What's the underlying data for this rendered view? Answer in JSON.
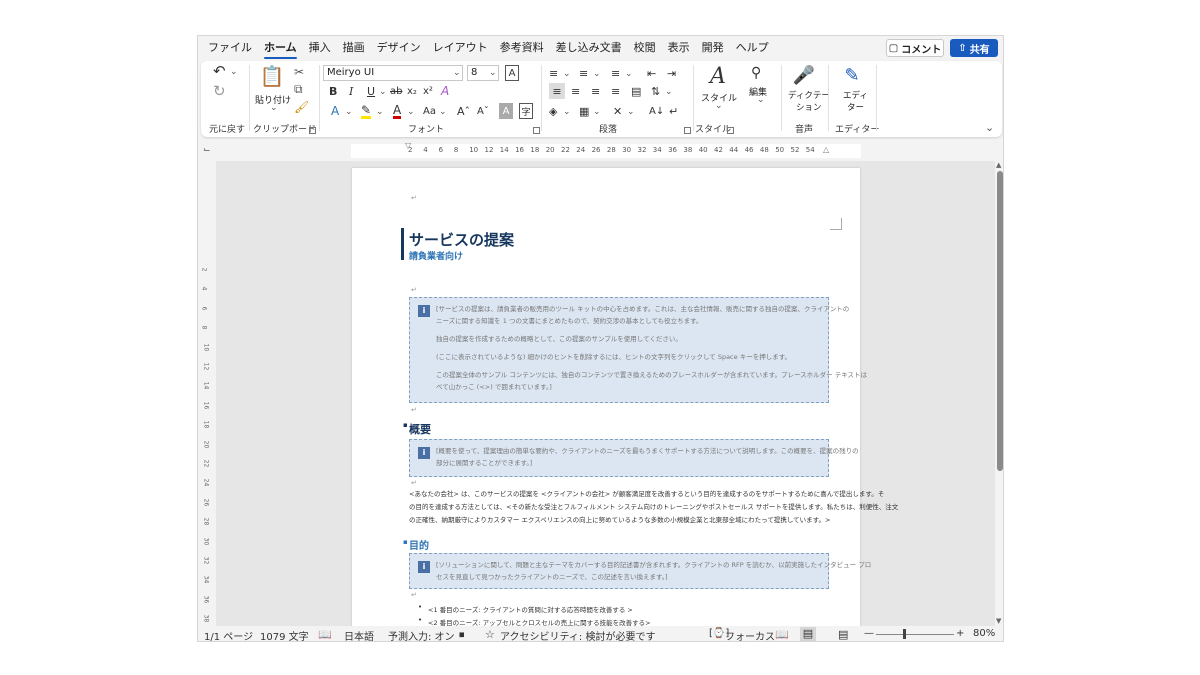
{
  "tabs": [
    "ファイル",
    "ホーム",
    "挿入",
    "描画",
    "デザイン",
    "レイアウト",
    "参考資料",
    "差し込み文書",
    "校閲",
    "表示",
    "開発",
    "ヘルプ"
  ],
  "comment_label": "コメント",
  "share_label": "共有",
  "ribbon": {
    "undo_group": "元に戻す",
    "clipboard_group": "クリップボード",
    "paste_label": "貼り付け",
    "font_group": "フォント",
    "font_name": "Meiryo UI",
    "font_size": "8",
    "paragraph_group": "段落",
    "styles_group": "スタイル",
    "styles_btn": "スタイル",
    "editing_btn": "編集",
    "dictation_btn1": "ディクテー",
    "dictation_btn2": "ション",
    "voice_group": "音声",
    "editor_btn1": "エディ",
    "editor_btn2": "ター",
    "editor_group": "エディター"
  },
  "ruler_ticks": [
    "2",
    "4",
    "6",
    "8",
    "10",
    "12",
    "14",
    "16",
    "18",
    "20",
    "22",
    "24",
    "26",
    "28",
    "30",
    "32",
    "34",
    "36",
    "38",
    "40",
    "42",
    "44",
    "46",
    "48",
    "50",
    "52",
    "54"
  ],
  "vruler_ticks": [
    "2",
    "4",
    "6",
    "8",
    "10",
    "12",
    "14",
    "16",
    "18",
    "20",
    "22",
    "24",
    "26",
    "28",
    "30",
    "32",
    "34",
    "36",
    "38"
  ],
  "doc": {
    "title": "サービスの提案",
    "subtitle": "請負業者向け",
    "tip1": [
      "[サービスの提案は、請負業者の販売用のツール キットの中心を占めます。これは、主な会社情報、販売に関する独自の提案、クライアントの",
      "ニーズに関する知識を 1 つの文書にまとめたもので、契約交渉の基本としても役立ちます。",
      "独自の提案を作成するための概略として、この提案のサンプルを使用してください。",
      "(ここに表示されているような) 細かけのヒントを削除するには、ヒントの文字列をクリックして Space キーを押します。",
      "この提案全体のサンプル コンテンツには、独自のコンテンツで置き換えるためのプレースホルダーが含まれています。プレースホルダー テキストは",
      "べて山かっこ (<>) で囲まれています。]"
    ],
    "h_overview": "概要",
    "tip2": [
      "[概要を使って、提案理由の簡単な要約や、クライアントのニーズを最もうまくサポートする方法について説明します。この概要を、提案の残りの",
      "部分に展開することができます。]"
    ],
    "body1": [
      "<あなたの会社> は、このサービスの提案を <クライアントの会社> が顧客満足度を改善するという目的を達成するのをサポートするために喜んで提出します。そ",
      "の目的を達成する方法としては、<その新たな受注とフルフィルメント システム向けのトレーニングやポストセールス サポートを提供します。私たちは、利便性、注文",
      "の正確性、納期厳守によりカスタマー エクスペリエンスの向上に努めているような多数の小規模企業と北東部全域にわたって提携しています。> "
    ],
    "h_purpose": "目的",
    "tip3": [
      "[ソリューションに関して、問題と主なテーマをカバーする目的記述書が含まれます。クライアントの RFP を読むか、以前実施したインタビュー プロ",
      "セスを見直して見つかったクライアントのニーズで、この記述を言い換えます。]"
    ],
    "bullets": [
      "<1 番目のニーズ: クライアントの質問に対する応答時間を改善する >",
      "<2 番目のニーズ: アップセルとクロスセルの売上に関する技能を改善する>"
    ]
  },
  "status": {
    "page": "1/1 ページ",
    "words": "1079 文字",
    "language": "日本語",
    "prediction": "予測入力: オン",
    "accessibility": "アクセシビリティ: 検討が必要です",
    "focus": "フォーカス",
    "zoom": "80%"
  }
}
